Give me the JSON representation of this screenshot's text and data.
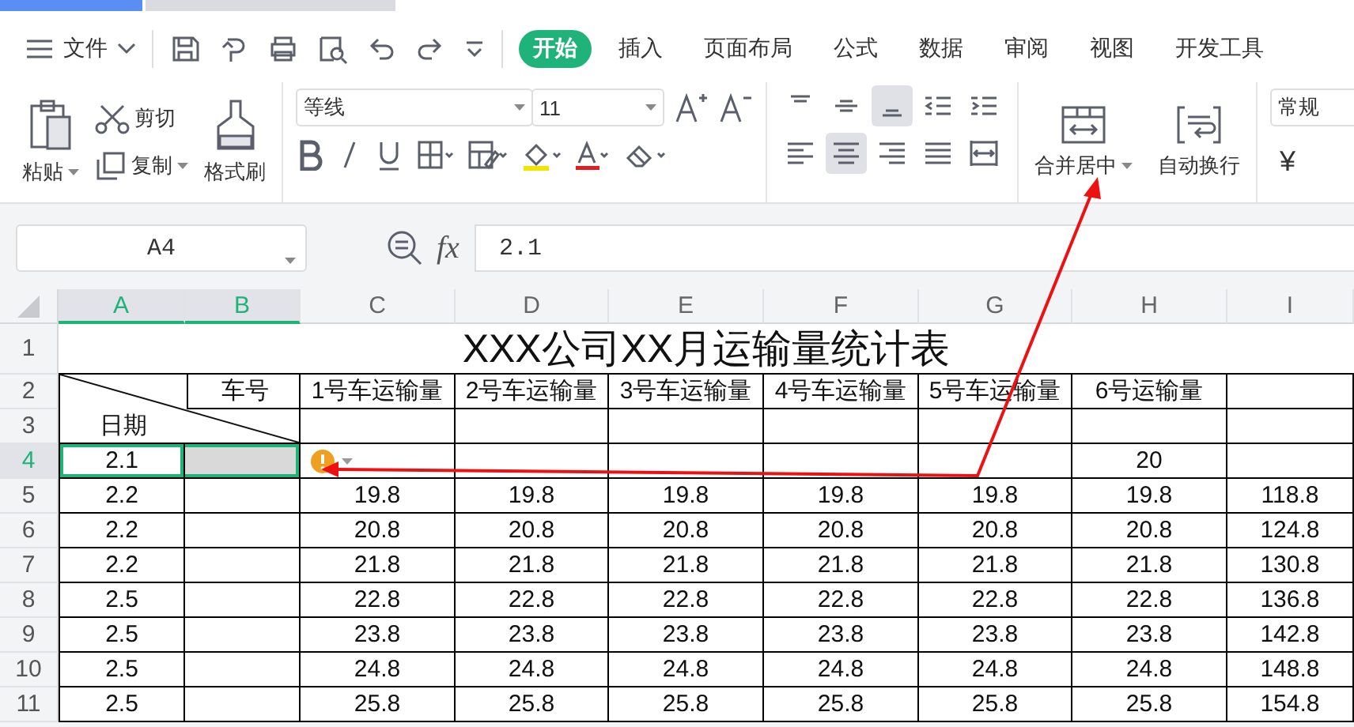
{
  "document_tabs": [
    {
      "selected": true
    },
    {
      "selected": false
    }
  ],
  "menu": {
    "label": "文件"
  },
  "tabs": [
    {
      "label": "开始",
      "selected": true
    },
    {
      "label": "插入",
      "selected": false
    },
    {
      "label": "页面布局",
      "selected": false
    },
    {
      "label": "公式",
      "selected": false
    },
    {
      "label": "数据",
      "selected": false
    },
    {
      "label": "审阅",
      "selected": false
    },
    {
      "label": "视图",
      "selected": false
    },
    {
      "label": "开发工具",
      "selected": false
    }
  ],
  "ribbon": {
    "paste": "粘贴",
    "cut": "剪切",
    "copy": "复制",
    "format_painter": "格式刷",
    "font_name": "等线",
    "font_size": "11",
    "vertical_align": [
      {
        "selected": false
      },
      {
        "selected": false
      },
      {
        "selected": true
      }
    ],
    "horizontal_align": [
      {
        "selected": false
      },
      {
        "selected": true
      },
      {
        "selected": false
      },
      {
        "selected": false
      }
    ],
    "merge": "合并居中",
    "wrap": "自动换行",
    "number_format": "常规",
    "currency": "¥"
  },
  "formula_bar": {
    "cell_ref": "A4",
    "fx_label": "fx",
    "value": "2.1"
  },
  "sheet": {
    "columns": [
      {
        "label": "A",
        "selected": true
      },
      {
        "label": "B",
        "selected": true
      },
      {
        "label": "C",
        "selected": false
      },
      {
        "label": "D",
        "selected": false
      },
      {
        "label": "E",
        "selected": false
      },
      {
        "label": "F",
        "selected": false
      },
      {
        "label": "G",
        "selected": false
      },
      {
        "label": "H",
        "selected": false
      },
      {
        "label": "I",
        "selected": false
      }
    ],
    "row_numbers": [
      {
        "label": "1",
        "selected": false
      },
      {
        "label": "2",
        "selected": false
      },
      {
        "label": "3",
        "selected": false
      },
      {
        "label": "4",
        "selected": true
      },
      {
        "label": "5",
        "selected": false
      },
      {
        "label": "6",
        "selected": false
      },
      {
        "label": "7",
        "selected": false
      },
      {
        "label": "8",
        "selected": false
      },
      {
        "label": "9",
        "selected": false
      },
      {
        "label": "10",
        "selected": false
      },
      {
        "label": "11",
        "selected": false
      }
    ],
    "title": "XXX公司XX月运输量统计表",
    "corner_top": "车号",
    "corner_bottom": "日期",
    "headers": [
      "1号车运输量",
      "2号车运输量",
      "3号车运输量",
      "4号车运输量",
      "5号车运输量",
      "6号运输量"
    ],
    "rows": [
      {
        "kind": "partial",
        "date": "2.1",
        "selected": true,
        "warning": true,
        "last_value": "20"
      },
      {
        "kind": "full",
        "date": "2.2",
        "selected": false,
        "values": [
          "19.8",
          "19.8",
          "19.8",
          "19.8",
          "19.8",
          "19.8"
        ],
        "total": "118.8"
      },
      {
        "kind": "full",
        "date": "2.2",
        "selected": false,
        "values": [
          "20.8",
          "20.8",
          "20.8",
          "20.8",
          "20.8",
          "20.8"
        ],
        "total": "124.8"
      },
      {
        "kind": "full",
        "date": "2.2",
        "selected": false,
        "values": [
          "21.8",
          "21.8",
          "21.8",
          "21.8",
          "21.8",
          "21.8"
        ],
        "total": "130.8"
      },
      {
        "kind": "full",
        "date": "2.5",
        "selected": false,
        "values": [
          "22.8",
          "22.8",
          "22.8",
          "22.8",
          "22.8",
          "22.8"
        ],
        "total": "136.8"
      },
      {
        "kind": "full",
        "date": "2.5",
        "selected": false,
        "values": [
          "23.8",
          "23.8",
          "23.8",
          "23.8",
          "23.8",
          "23.8"
        ],
        "total": "142.8"
      },
      {
        "kind": "full",
        "date": "2.5",
        "selected": false,
        "values": [
          "24.8",
          "24.8",
          "24.8",
          "24.8",
          "24.8",
          "24.8"
        ],
        "total": "148.8"
      },
      {
        "kind": "full",
        "date": "2.5",
        "selected": false,
        "values": [
          "25.8",
          "25.8",
          "25.8",
          "25.8",
          "25.8",
          "25.8"
        ],
        "total": "154.8"
      }
    ]
  }
}
